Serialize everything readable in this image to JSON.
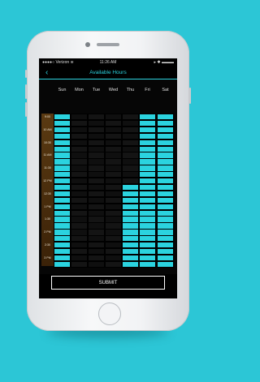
{
  "status": {
    "carrier": "●●●●○ Verizon ≋",
    "time": "11:26 AM",
    "right": "▸ ✱ ▬▬▬"
  },
  "nav": {
    "back_icon": "chevron-left",
    "title": "Available Hours"
  },
  "days": [
    "Sun",
    "Mon",
    "Tue",
    "Wed",
    "Thu",
    "Fri",
    "Sat"
  ],
  "times": [
    "9:00",
    "10 AM",
    "10:30",
    "11 AM",
    "11:30",
    "12 PM",
    "12:30",
    "1 PM",
    "1:30",
    "2 PM",
    "2:30",
    "3 PM"
  ],
  "availability_by_day": {
    "Sun": "available",
    "Mon": "unavailable",
    "Tue": "unavailable",
    "Wed": "unavailable",
    "Thu": "unavailable until 12 PM, available after",
    "Fri": "available",
    "Sat": "available"
  },
  "submit_label": "SUBMIT",
  "colors": {
    "background": "#2cc6d6",
    "available": "#2bd3df",
    "unavailable": "#141414",
    "time_column": "#5a3a12"
  }
}
